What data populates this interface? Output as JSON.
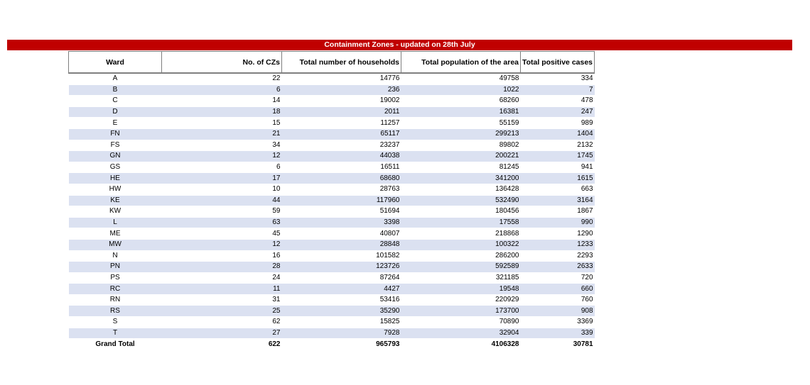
{
  "title": "Containment Zones - updated on 28th July",
  "colors": {
    "banner": "#c00000",
    "row_stripe": "#dbe1f1"
  },
  "headers": [
    "Ward",
    "No. of CZs",
    "Total number of households",
    "Total population of the area",
    "Total positive cases"
  ],
  "rows": [
    [
      "A",
      "22",
      "14776",
      "49758",
      "334"
    ],
    [
      "B",
      "6",
      "236",
      "1022",
      "7"
    ],
    [
      "C",
      "14",
      "19002",
      "68260",
      "478"
    ],
    [
      "D",
      "18",
      "2011",
      "16381",
      "247"
    ],
    [
      "E",
      "15",
      "11257",
      "55159",
      "989"
    ],
    [
      "FN",
      "21",
      "65117",
      "299213",
      "1404"
    ],
    [
      "FS",
      "34",
      "23237",
      "89802",
      "2132"
    ],
    [
      "GN",
      "12",
      "44038",
      "200221",
      "1745"
    ],
    [
      "GS",
      "6",
      "16511",
      "81245",
      "941"
    ],
    [
      "HE",
      "17",
      "68680",
      "341200",
      "1615"
    ],
    [
      "HW",
      "10",
      "28763",
      "136428",
      "663"
    ],
    [
      "KE",
      "44",
      "117960",
      "532490",
      "3164"
    ],
    [
      "KW",
      "59",
      "51694",
      "180456",
      "1867"
    ],
    [
      "L",
      "63",
      "3398",
      "17558",
      "990"
    ],
    [
      "ME",
      "45",
      "40807",
      "218868",
      "1290"
    ],
    [
      "MW",
      "12",
      "28848",
      "100322",
      "1233"
    ],
    [
      "N",
      "16",
      "101582",
      "286200",
      "2293"
    ],
    [
      "PN",
      "28",
      "123726",
      "592589",
      "2633"
    ],
    [
      "PS",
      "24",
      "87264",
      "321185",
      "720"
    ],
    [
      "RC",
      "11",
      "4427",
      "19548",
      "660"
    ],
    [
      "RN",
      "31",
      "53416",
      "220929",
      "760"
    ],
    [
      "RS",
      "25",
      "35290",
      "173700",
      "908"
    ],
    [
      "S",
      "62",
      "15825",
      "70890",
      "3369"
    ],
    [
      "T",
      "27",
      "7928",
      "32904",
      "339"
    ]
  ],
  "total": [
    "Grand Total",
    "622",
    "965793",
    "4106328",
    "30781"
  ]
}
